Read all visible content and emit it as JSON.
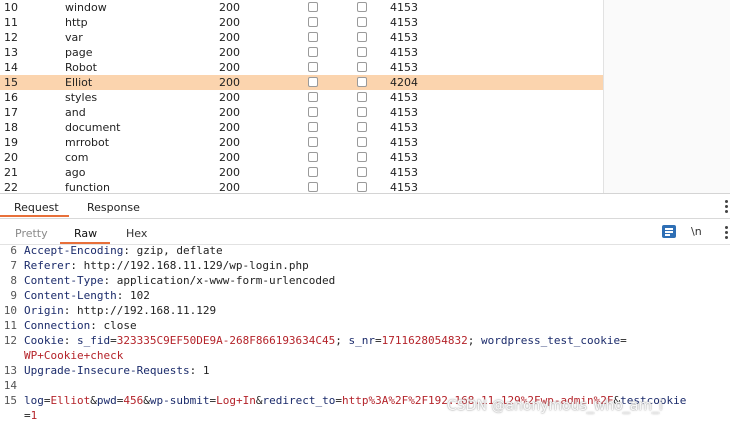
{
  "results": {
    "rows": [
      {
        "num": "10",
        "payload": "window",
        "status": "200",
        "length": "4153",
        "selected": false
      },
      {
        "num": "11",
        "payload": "http",
        "status": "200",
        "length": "4153",
        "selected": false
      },
      {
        "num": "12",
        "payload": "var",
        "status": "200",
        "length": "4153",
        "selected": false
      },
      {
        "num": "13",
        "payload": "page",
        "status": "200",
        "length": "4153",
        "selected": false
      },
      {
        "num": "14",
        "payload": "Robot",
        "status": "200",
        "length": "4153",
        "selected": false
      },
      {
        "num": "15",
        "payload": "Elliot",
        "status": "200",
        "length": "4204",
        "selected": true
      },
      {
        "num": "16",
        "payload": "styles",
        "status": "200",
        "length": "4153",
        "selected": false
      },
      {
        "num": "17",
        "payload": "and",
        "status": "200",
        "length": "4153",
        "selected": false
      },
      {
        "num": "18",
        "payload": "document",
        "status": "200",
        "length": "4153",
        "selected": false
      },
      {
        "num": "19",
        "payload": "mrrobot",
        "status": "200",
        "length": "4153",
        "selected": false
      },
      {
        "num": "20",
        "payload": "com",
        "status": "200",
        "length": "4153",
        "selected": false
      },
      {
        "num": "21",
        "payload": "ago",
        "status": "200",
        "length": "4153",
        "selected": false
      },
      {
        "num": "22",
        "payload": "function",
        "status": "200",
        "length": "4153",
        "selected": false
      }
    ]
  },
  "editor": {
    "tabs": {
      "request": "Request",
      "response": "Response"
    },
    "subtabs": {
      "pretty": "Pretty",
      "raw": "Raw",
      "hex": "Hex"
    },
    "ln_toggle": "\\n",
    "lines": [
      {
        "n": "6",
        "parts": [
          {
            "t": "Accept-Encoding",
            "c": "hn"
          },
          {
            "t": ": gzip, deflate",
            "c": "pl"
          }
        ]
      },
      {
        "n": "7",
        "parts": [
          {
            "t": "Referer",
            "c": "hn"
          },
          {
            "t": ": http://192.168.11.129/wp-login.php",
            "c": "pl"
          }
        ]
      },
      {
        "n": "8",
        "parts": [
          {
            "t": "Content-Type",
            "c": "hn"
          },
          {
            "t": ": application/x-www-form-urlencoded",
            "c": "pl"
          }
        ]
      },
      {
        "n": "9",
        "parts": [
          {
            "t": "Content-Length",
            "c": "hn"
          },
          {
            "t": ": 102",
            "c": "pl"
          }
        ]
      },
      {
        "n": "10",
        "parts": [
          {
            "t": "Origin",
            "c": "hn"
          },
          {
            "t": ": http://192.168.11.129",
            "c": "pl"
          }
        ]
      },
      {
        "n": "11",
        "parts": [
          {
            "t": "Connection",
            "c": "hn"
          },
          {
            "t": ": close",
            "c": "pl"
          }
        ]
      },
      {
        "n": "12",
        "parts": [
          {
            "t": "Cookie",
            "c": "hn"
          },
          {
            "t": ": ",
            "c": "pl"
          },
          {
            "t": "s_fid",
            "c": "pn"
          },
          {
            "t": "=",
            "c": "pl"
          },
          {
            "t": "323335C9EF50DE9A-268F866193634C45",
            "c": "pv"
          },
          {
            "t": "; ",
            "c": "pl"
          },
          {
            "t": "s_nr",
            "c": "pn"
          },
          {
            "t": "=",
            "c": "pl"
          },
          {
            "t": "1711628054832",
            "c": "pv"
          },
          {
            "t": "; ",
            "c": "pl"
          },
          {
            "t": "wordpress_test_cookie",
            "c": "pn"
          },
          {
            "t": "=",
            "c": "pl"
          }
        ]
      },
      {
        "n": "",
        "parts": [
          {
            "t": "WP+Cookie+check",
            "c": "pv"
          }
        ]
      },
      {
        "n": "13",
        "parts": [
          {
            "t": "Upgrade-Insecure-Requests",
            "c": "hn"
          },
          {
            "t": ": 1",
            "c": "pl"
          }
        ]
      },
      {
        "n": "14",
        "parts": []
      },
      {
        "n": "15",
        "parts": [
          {
            "t": "log",
            "c": "pn"
          },
          {
            "t": "=",
            "c": "pl"
          },
          {
            "t": "Elliot",
            "c": "pv"
          },
          {
            "t": "&",
            "c": "pl"
          },
          {
            "t": "pwd",
            "c": "pn"
          },
          {
            "t": "=",
            "c": "pl"
          },
          {
            "t": "456",
            "c": "pv"
          },
          {
            "t": "&",
            "c": "pl"
          },
          {
            "t": "wp-submit",
            "c": "pn"
          },
          {
            "t": "=",
            "c": "pl"
          },
          {
            "t": "Log+In",
            "c": "pv"
          },
          {
            "t": "&",
            "c": "pl"
          },
          {
            "t": "redirect_to",
            "c": "pn"
          },
          {
            "t": "=",
            "c": "pl"
          },
          {
            "t": "http%3A%2F%2F192.168.11.129%2Fwp-admin%2F",
            "c": "pv"
          },
          {
            "t": "&",
            "c": "pl"
          },
          {
            "t": "testcookie",
            "c": "pn"
          }
        ]
      },
      {
        "n": "",
        "parts": [
          {
            "t": "=",
            "c": "pl"
          },
          {
            "t": "1",
            "c": "pv"
          }
        ]
      }
    ]
  },
  "watermark": "CSDN @anonymous_who_am_i",
  "colors": {
    "accent": "#e8703a",
    "selected_row": "#fbd4ae",
    "param_value": "#b4232a",
    "header_name": "#1b2b6b"
  }
}
